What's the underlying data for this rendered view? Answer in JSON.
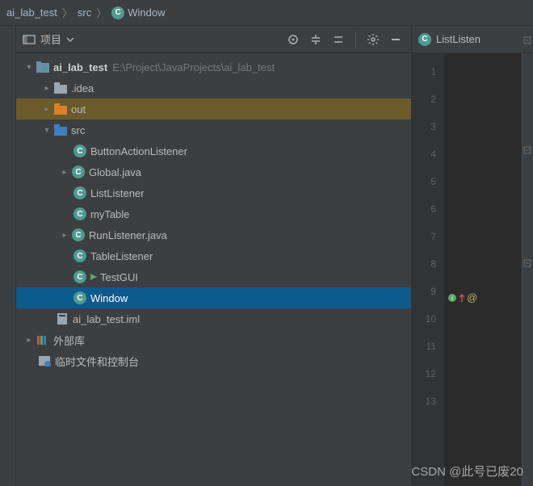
{
  "breadcrumb": {
    "root": "ai_lab_test",
    "mid": "src",
    "leaf": "Window"
  },
  "panel": {
    "title": "项目"
  },
  "tree": {
    "root": {
      "name": "ai_lab_test",
      "path": "E:\\Project\\JavaProjects\\ai_lab_test"
    },
    "idea": ".idea",
    "out": "out",
    "src": "src",
    "files": {
      "f0": "ButtonActionListener",
      "f1": "Global.java",
      "f2": "ListListener",
      "f3": "myTable",
      "f4": "RunListener.java",
      "f5": "TableListener",
      "f6": "TestGUI",
      "f7": "Window"
    },
    "iml": "ai_lab_test.iml",
    "ext": "外部库",
    "scratch": "临时文件和控制台"
  },
  "editor": {
    "tab": "ListListen",
    "lines": [
      "1",
      "2",
      "3",
      "4",
      "5",
      "6",
      "7",
      "8",
      "9",
      "10",
      "11",
      "12",
      "13"
    ],
    "annotation": "@"
  },
  "watermark": "CSDN @此号已废20"
}
